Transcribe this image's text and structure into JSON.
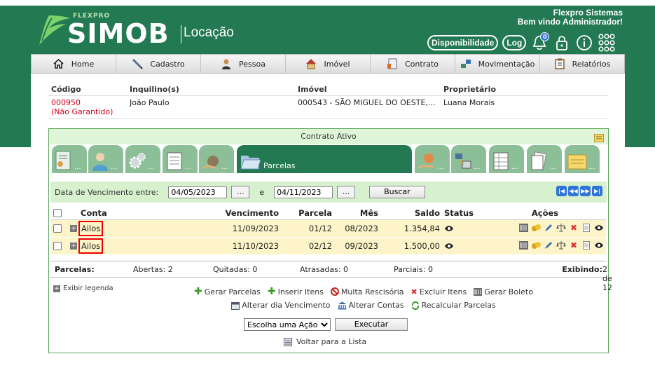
{
  "header": {
    "brand_small": "FLEXPRO",
    "brand": "SIMOB",
    "brand_sub": "Locação",
    "company_name": "Flexpro Sistemas",
    "welcome": "Bem vindo Administrador!",
    "availability_label": "Disponibilidade",
    "log_label": "Log",
    "notification_count": "0",
    "colors": {
      "green": "#237a52",
      "light_green": "#8cbf98"
    }
  },
  "nav": {
    "items": [
      {
        "label": "Home",
        "icon": "home-icon"
      },
      {
        "label": "Cadastro",
        "icon": "pen-icon"
      },
      {
        "label": "Pessoa",
        "icon": "person-icon"
      },
      {
        "label": "Imóvel",
        "icon": "house-icon"
      },
      {
        "label": "Contrato",
        "icon": "contract-icon"
      },
      {
        "label": "Movimentação",
        "icon": "transfer-icon"
      },
      {
        "label": "Relatórios",
        "icon": "report-icon"
      }
    ]
  },
  "info": {
    "headers": {
      "codigo": "Código",
      "inquilino": "Inquilino(s)",
      "imovel": "Imóvel",
      "proprietario": "Proprietário"
    },
    "codigo": "000950",
    "codigo_status": "(Não Garantido)",
    "inquilino": "João Paulo",
    "imovel": "000543 - SÃO MIGUEL DO OESTE,...",
    "proprietario": "Luana Morais"
  },
  "contract": {
    "title": "Contrato Ativo",
    "active_tab": "Parcelas",
    "tab_placeholder": "...",
    "filter": {
      "label": "Data de Vencimento entre:",
      "from": "04/05/2023",
      "to": "04/11/2023",
      "and": "e",
      "dots": "...",
      "search": "Buscar"
    },
    "columns": {
      "conta": "Conta",
      "vencimento": "Vencimento",
      "parcela": "Parcela",
      "mes": "Mês",
      "saldo": "Saldo",
      "status": "Status",
      "acoes": "Ações"
    },
    "rows": [
      {
        "conta": "Ailos",
        "vencimento": "11/09/2023",
        "parcela": "01/12",
        "mes": "08/2023",
        "saldo": "1.354,84"
      },
      {
        "conta": "Ailos",
        "vencimento": "11/10/2023",
        "parcela": "02/12",
        "mes": "09/2023",
        "saldo": "1.500,00"
      }
    ],
    "summary": {
      "label": "Parcelas:",
      "abertas": "Abertas: 2",
      "quitadas": "Quitadas: 0",
      "atrasadas": "Atrasadas: 0",
      "parciais": "Parciais: 0",
      "exibindo_label": "Exibindo:",
      "exibindo_value": "2 de 12"
    },
    "legend": "Exibir legenda",
    "links": {
      "gerar_parcelas": "Gerar Parcelas",
      "inserir_itens": "Inserir Itens",
      "multa": "Multa Rescisória",
      "excluir": "Excluir Itens",
      "gerar_boleto": "Gerar Boleto",
      "alterar_dia": "Alterar dia Vencimento",
      "alterar_contas": "Alterar Contas",
      "recalcular": "Recalcular Parcelas"
    },
    "action_select": "Escolha uma Ação",
    "execute": "Executar",
    "back": "Voltar para a Lista"
  }
}
